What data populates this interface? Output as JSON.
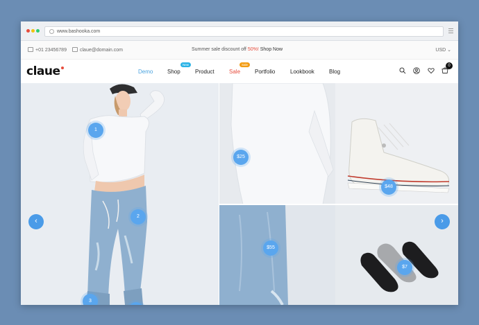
{
  "browser": {
    "url": "www.bashooka.com"
  },
  "topbar": {
    "phone": "+01 23456789",
    "email": "claue@domain.com",
    "promo_text": "Summer sale discount off",
    "promo_percent": "50%!",
    "promo_link": "Shop Now",
    "currency": "USD"
  },
  "header": {
    "logo": "claue",
    "nav": [
      {
        "label": "Demo"
      },
      {
        "label": "Shop"
      },
      {
        "label": "Product"
      },
      {
        "label": "Sale"
      },
      {
        "label": "Portfolio"
      },
      {
        "label": "Lookbook"
      },
      {
        "label": "Blog"
      }
    ],
    "badges": {
      "new": "New",
      "sale": "Sale"
    },
    "cart_count": "0"
  },
  "hero": {
    "hotspots": [
      "1",
      "2",
      "3",
      "$25",
      "$55",
      "$48",
      "$7"
    ]
  },
  "colors": {
    "accent": "#4aa3df",
    "sale": "#e74c3c",
    "hotspot": "#5aa6ee",
    "background": "#6b8db4"
  }
}
